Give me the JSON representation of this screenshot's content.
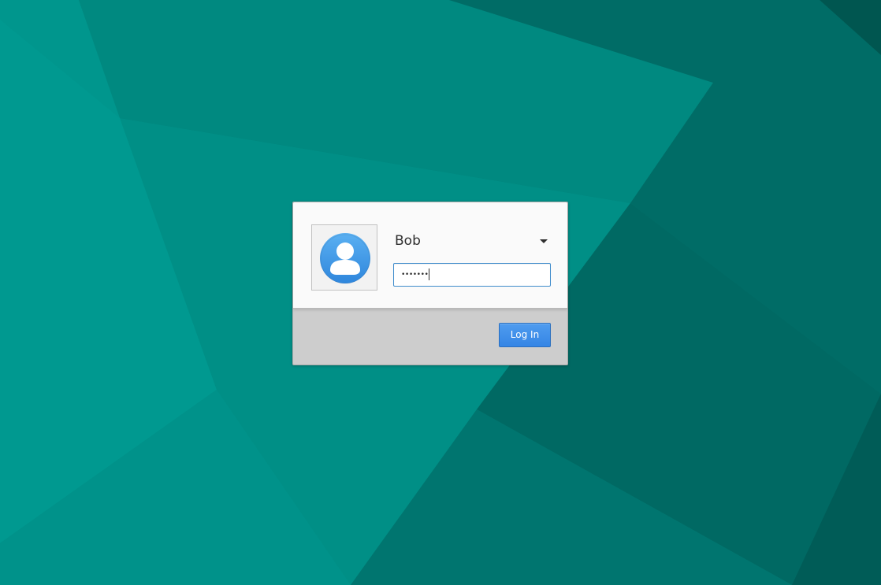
{
  "theme": {
    "wallpaper_base": "#007f76",
    "accent_blue": "#3585e5",
    "avatar_blue": "#3f94e4"
  },
  "login": {
    "selected_user": "Bob",
    "user_icon": "user-avatar-icon",
    "dropdown_icon": "chevron-down-icon",
    "password_value": "•••••••",
    "login_label": "Log In"
  }
}
